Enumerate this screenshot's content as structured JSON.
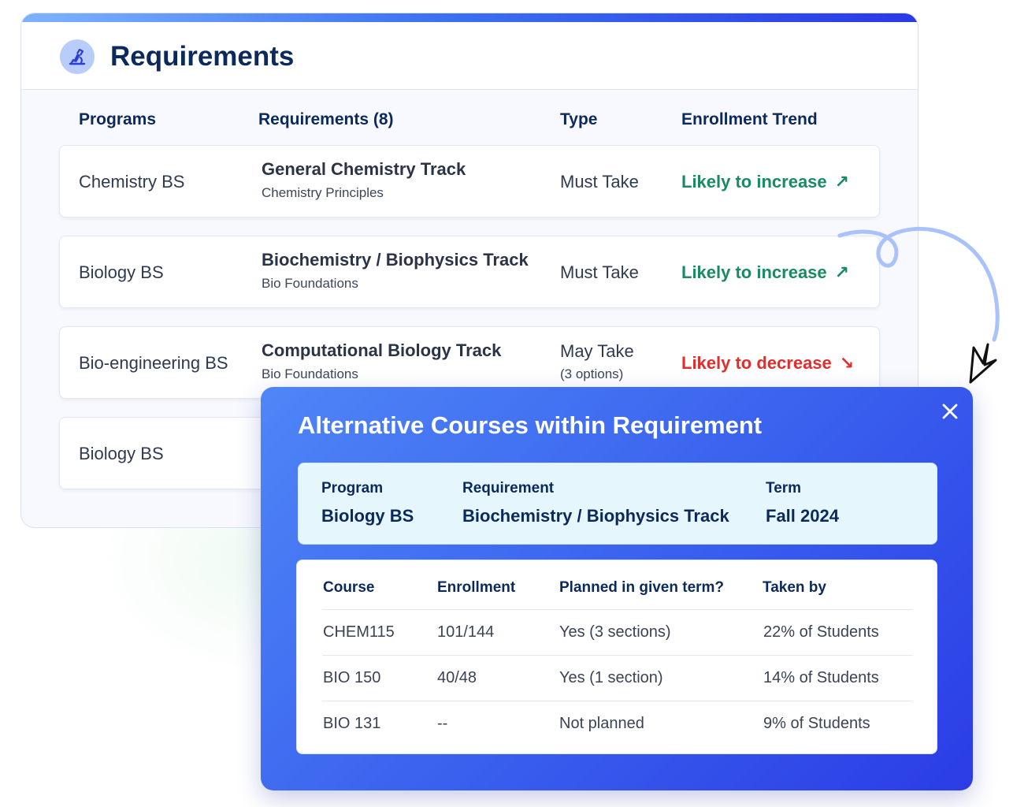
{
  "requirements": {
    "title": "Requirements",
    "headers": {
      "programs": "Programs",
      "requirements": "Requirements (8)",
      "type": "Type",
      "trend": "Enrollment Trend"
    },
    "rows": [
      {
        "program": "Chemistry BS",
        "requirement": "General Chemistry Track",
        "requirement_sub": "Chemistry Principles",
        "type": "Must Take",
        "type_sub": "",
        "trend": "Likely to increase",
        "trend_icon": "arrow-up-right-icon"
      },
      {
        "program": "Biology BS",
        "requirement": "Biochemistry / Biophysics Track",
        "requirement_sub": "Bio Foundations",
        "type": "Must Take",
        "type_sub": "",
        "trend": "Likely to increase",
        "trend_icon": "arrow-up-right-icon"
      },
      {
        "program": "Bio-engineering BS",
        "requirement": "Computational Biology Track",
        "requirement_sub": "Bio Foundations",
        "type": "May Take",
        "type_sub": "(3 options)",
        "trend": "Likely to decrease",
        "trend_icon": "arrow-down-right-icon"
      },
      {
        "program": "Biology BS"
      }
    ]
  },
  "alternatives": {
    "title": "Alternative Courses within Requirement",
    "info": {
      "program_label": "Program",
      "program_value": "Biology BS",
      "requirement_label": "Requirement",
      "requirement_value": "Biochemistry / Biophysics Track",
      "term_label": "Term",
      "term_value": "Fall 2024"
    },
    "table": {
      "headers": [
        "Course",
        "Enrollment",
        "Planned in given term?",
        "Taken by"
      ],
      "rows": [
        [
          "CHEM115",
          "101/144",
          "Yes (3 sections)",
          "22% of Students"
        ],
        [
          "BIO 150",
          "40/48",
          "Yes (1 section)",
          "14% of Students"
        ],
        [
          "BIO 131",
          "--",
          "Not planned",
          "9% of Students"
        ]
      ]
    }
  },
  "colors": {
    "navy": "#0b2a5b",
    "trend_up": "#1a8a62",
    "trend_down": "#e02e2e",
    "panel_blue": "#3a62ee",
    "info_bg": "#e6f6fd"
  },
  "icons": {
    "header": "microscope-icon",
    "close": "close-icon"
  }
}
